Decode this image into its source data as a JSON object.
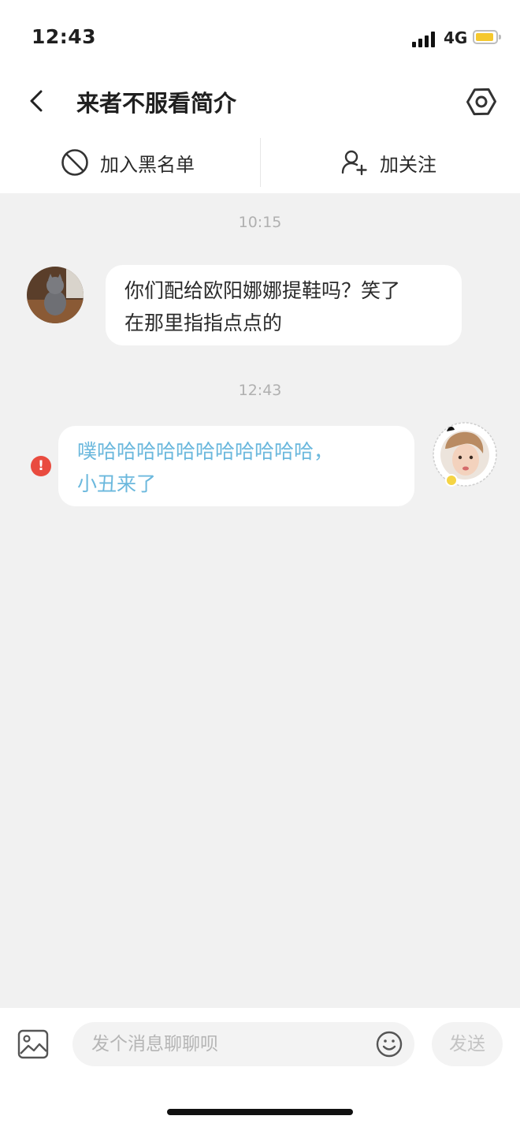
{
  "status_bar": {
    "time": "12:43",
    "network": "4G",
    "battery_color": "#f5c82e"
  },
  "nav": {
    "title": "来者不服看简介",
    "back_icon": "chevron-left-icon",
    "settings_icon": "hexagon-settings-icon"
  },
  "actions": {
    "blacklist": {
      "label": "加入黑名单",
      "icon": "block-icon"
    },
    "follow": {
      "label": "加关注",
      "icon": "add-user-icon"
    }
  },
  "messages": [
    {
      "timestamp": "10:15",
      "direction": "incoming",
      "lines": [
        "你们配给欧阳娜娜提鞋吗？笑了",
        "在那里指指点点的"
      ]
    },
    {
      "timestamp": "12:43",
      "direction": "outgoing",
      "status": "failed",
      "lines": [
        "噗哈哈哈哈哈哈哈哈哈哈哈，",
        "小丑来了"
      ]
    }
  ],
  "input": {
    "placeholder": "发个消息聊聊呗",
    "send_label": "发送",
    "image_icon": "image-icon",
    "emoji_icon": "smiley-icon"
  },
  "colors": {
    "outgoing_text": "#6bb8dd",
    "failed_badge": "#e94b3f",
    "background": "#f1f1f1"
  }
}
